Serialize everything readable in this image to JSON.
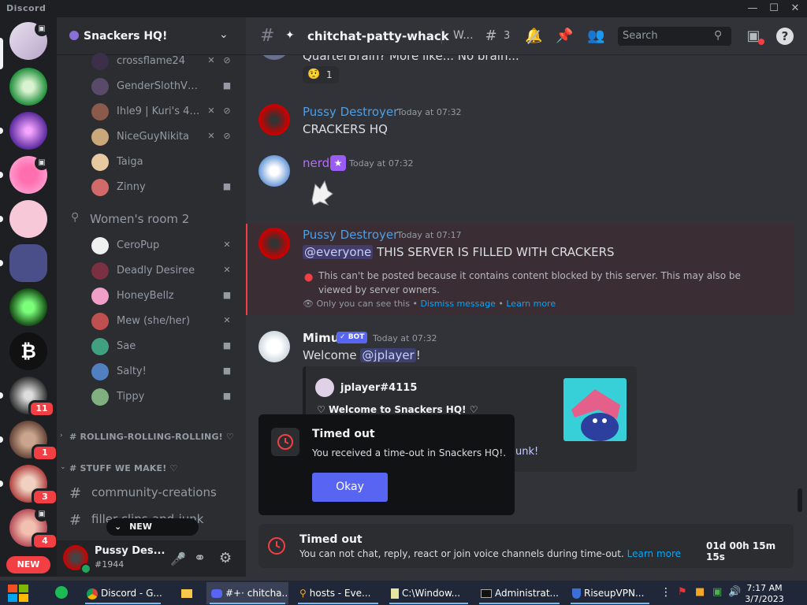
{
  "app": {
    "title": "Discord"
  },
  "server": {
    "name": "Snackers HQ!"
  },
  "voice_users_top": [
    {
      "name": "crossflame24"
    },
    {
      "name": "GenderSlothVT (Th..."
    },
    {
      "name": "Ihle9 | Kuri's 4th..."
    },
    {
      "name": "NiceGuyNikita"
    },
    {
      "name": "Taiga"
    },
    {
      "name": "Zinny"
    }
  ],
  "voice_channel": {
    "name": "Women's room 2"
  },
  "voice_users_room2": [
    {
      "name": "CeroPup"
    },
    {
      "name": "Deadly Desiree"
    },
    {
      "name": "HoneyBellz"
    },
    {
      "name": "Mew (she/her)"
    },
    {
      "name": "Sae"
    },
    {
      "name": "Salty!"
    },
    {
      "name": "Tippy"
    }
  ],
  "categories": [
    {
      "label": "# ROLLING-ROLLING-ROLLING! ♡"
    },
    {
      "label": "# STUFF WE MAKE! ♡"
    }
  ],
  "text_channels": [
    {
      "name": "community-creations"
    },
    {
      "name": "filler-clips-and-junk"
    }
  ],
  "new_unreads": "NEW UNREADS",
  "user_panel": {
    "name": "Pussy Des...",
    "tag": "#1944"
  },
  "guild_badges": [
    "11",
    "1",
    "3",
    "4"
  ],
  "new_badge": "NEW",
  "header": {
    "channel": "chitchat-patty-whack",
    "extra": "W...",
    "thread_count": "3",
    "search_placeholder": "Search"
  },
  "messages": {
    "partial_top": "QuarterBrain? More like... No brain...",
    "reaction_count": "1",
    "m1": {
      "author": "Pussy Destroyer",
      "time": "Today at 07:32",
      "text": "CRACKERS HQ"
    },
    "m2": {
      "author": "nerd",
      "time": "Today at 07:32"
    },
    "m3": {
      "author": "Pussy Destroyer",
      "time": "Today at 07:17",
      "mention": "@everyone",
      "text": "THIS SERVER IS FILLED WITH CRACKERS",
      "blocked": "This can't be posted because it contains content blocked by this server. This may also be viewed by server owners.",
      "only_you": "Only you can see this",
      "dismiss": "Dismiss message",
      "learn": "Learn more"
    },
    "m4": {
      "author": "Mimu",
      "bot_tag": "BOT",
      "time": "Today at 07:32",
      "welcome": "Welcome",
      "mention": "@jplayer",
      "excl": "!",
      "embed_author": "jplayer#4115",
      "embed_title": "Welcome to Snackers HQ!",
      "embed_tail": "unk!"
    }
  },
  "modal": {
    "title": "Timed out",
    "body": "You received a time-out in Snackers HQ!.",
    "button": "Okay"
  },
  "timeout_bar": {
    "title": "Timed out",
    "body": "You can not chat, reply, react or join voice channels during time-out.",
    "link": "Learn more",
    "remaining": "01d 00h 15m 15s"
  },
  "taskbar": {
    "items": [
      {
        "label": "Discord - G..."
      },
      {
        "label": "#+· chitcha..."
      },
      {
        "label": "hosts - Eve..."
      },
      {
        "label": "C:\\Window..."
      },
      {
        "label": "Administrat..."
      },
      {
        "label": "RiseupVPN..."
      }
    ],
    "time": "7:17 AM",
    "date": "3/7/2023"
  },
  "colors": {
    "accent": "#5865f2",
    "danger": "#f23f43",
    "link": "#00a8fc",
    "author_red": "#4e9fe5",
    "nerd": "#b66cf5"
  }
}
